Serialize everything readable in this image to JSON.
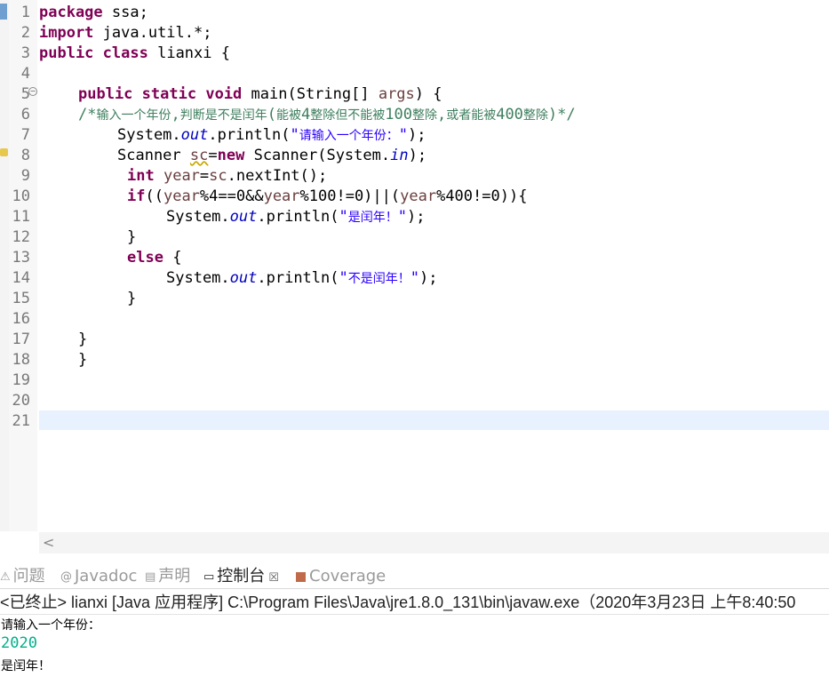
{
  "editor": {
    "line_numbers": [
      "1",
      "2",
      "3",
      "4",
      "5",
      "6",
      "7",
      "8",
      "9",
      "10",
      "11",
      "12",
      "13",
      "14",
      "15",
      "16",
      "17",
      "18",
      "19",
      "20",
      "21"
    ],
    "lines": {
      "l1": {
        "kw": "package",
        "rest": " ssa;"
      },
      "l2": {
        "kw": "import",
        "rest": " java.util.*;"
      },
      "l3": {
        "kw1": "public",
        "kw2": "class",
        "rest": " lianxi {"
      },
      "l5": {
        "kw1": "public",
        "kw2": "static",
        "kw3": "void",
        "rest1": " main(String[] ",
        "param": "args",
        "rest2": ") {"
      },
      "l6": {
        "c1": "/*",
        "c2": "输入一个年份",
        "c3": ",",
        "c4": "判断是不是闰年",
        "c5": "(",
        "c6": "能被",
        "c7": "4",
        "c8": "整除但不能被",
        "c9": "100",
        "c10": "整除",
        "c11": ",",
        "c12": "或者能被",
        "c13": "400",
        "c14": "整除",
        "c15": ")*/"
      },
      "l7": {
        "a": "System.",
        "field": "out",
        "b": ".println(",
        "s1": "\"",
        "s2": "请输入一个年份：",
        "s3": "\"",
        "c": ");"
      },
      "l8": {
        "a": "Scanner ",
        "var": "sc",
        "b": "=",
        "kw": "new",
        "c": " Scanner(System.",
        "field": "in",
        "d": ");"
      },
      "l9": {
        "kw": "int",
        "sp": " ",
        "var1": "year",
        "a": "=",
        "var2": "sc",
        "b": ".nextInt();"
      },
      "l10": {
        "kw": "if",
        "a": "((",
        "v1": "year",
        "b": "%4==0&&",
        "v2": "year",
        "c": "%100!=0)||(",
        "v3": "year",
        "d": "%400!=0)){"
      },
      "l11": {
        "a": "System.",
        "field": "out",
        "b": ".println(",
        "s1": "\"",
        "s2": "是闰年！",
        "s3": "\"",
        "c": ");"
      },
      "l12": {
        "a": "}"
      },
      "l13": {
        "kw": "else",
        "a": " {"
      },
      "l14": {
        "a": "System.",
        "field": "out",
        "b": ".println(",
        "s1": "\"",
        "s2": "不是闰年！",
        "s3": "\"",
        "c": ");"
      },
      "l15": {
        "a": "}"
      },
      "l17": {
        "a": "}"
      },
      "l18": {
        "a": "}"
      }
    },
    "scroll_left_arrow": "<"
  },
  "console": {
    "tabs": [
      {
        "label": "问题",
        "icon": "problems-icon",
        "glyph": "⚠"
      },
      {
        "label": "Javadoc",
        "icon": "javadoc-icon",
        "glyph": "@"
      },
      {
        "label": "声明",
        "icon": "declaration-icon",
        "glyph": "▤"
      },
      {
        "label": "控制台",
        "icon": "console-icon",
        "glyph": "▭",
        "close": "☒"
      },
      {
        "label": "Coverage",
        "icon": "coverage-icon"
      }
    ],
    "header": "<已终止> lianxi [Java 应用程序] C:\\Program Files\\Java\\jre1.8.0_131\\bin\\javaw.exe（2020年3月23日 上午8:40:50",
    "output": [
      "请输入一个年份：",
      "2020",
      "是闰年！"
    ]
  },
  "colors": {
    "keyword": "#7f0055",
    "string": "#2a00ff",
    "comment": "#3f7f5f",
    "field": "#0000c0",
    "local_var": "#6a3e3e",
    "console_input": "#00b08a",
    "current_line": "#e8f2fe"
  }
}
